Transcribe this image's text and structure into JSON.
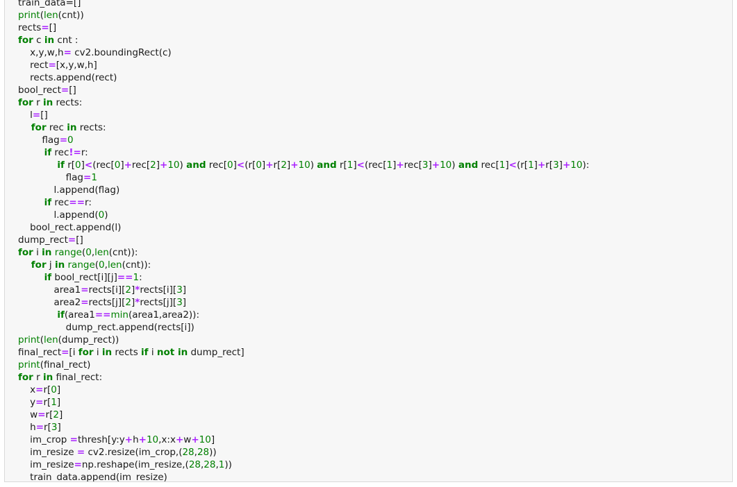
{
  "code_cell": {
    "lines": [
      [
        [
          "t",
          "train_data=[]"
        ]
      ],
      [
        [
          "b",
          "print"
        ],
        [
          "t",
          "("
        ],
        [
          "b",
          "len"
        ],
        [
          "t",
          "(cnt))"
        ]
      ],
      [
        [
          "t",
          "rects"
        ],
        [
          "o",
          "="
        ],
        [
          "t",
          "[]"
        ]
      ],
      [
        [
          "k",
          "for"
        ],
        [
          "t",
          " c "
        ],
        [
          "k",
          "in"
        ],
        [
          "t",
          " cnt :"
        ]
      ],
      [
        [
          "t",
          "    x,y,w,h"
        ],
        [
          "o",
          "="
        ],
        [
          "t",
          " cv2.boundingRect(c)"
        ]
      ],
      [
        [
          "t",
          "    rect"
        ],
        [
          "o",
          "="
        ],
        [
          "t",
          "[x,y,w,h]"
        ]
      ],
      [
        [
          "t",
          "    rects.append(rect)"
        ]
      ],
      [
        [
          "t",
          "bool_rect"
        ],
        [
          "o",
          "="
        ],
        [
          "t",
          "[]"
        ]
      ],
      [
        [
          "k",
          "for"
        ],
        [
          "t",
          " r "
        ],
        [
          "k",
          "in"
        ],
        [
          "t",
          " rects:"
        ]
      ],
      [
        [
          "t",
          "    l"
        ],
        [
          "o",
          "="
        ],
        [
          "t",
          "[]"
        ]
      ],
      [
        [
          "k",
          "    for"
        ],
        [
          "t",
          " rec "
        ],
        [
          "k",
          "in"
        ],
        [
          "t",
          " rects:"
        ]
      ],
      [
        [
          "t",
          "        flag"
        ],
        [
          "o",
          "="
        ],
        [
          "n",
          "0"
        ]
      ],
      [
        [
          "k",
          "        if"
        ],
        [
          "t",
          " rec"
        ],
        [
          "o",
          "!="
        ],
        [
          "t",
          "r:"
        ]
      ],
      [
        [
          "k",
          "            if"
        ],
        [
          "t",
          " r["
        ],
        [
          "n",
          "0"
        ],
        [
          "t",
          "]"
        ],
        [
          "o",
          "<"
        ],
        [
          "t",
          "(rec["
        ],
        [
          "n",
          "0"
        ],
        [
          "t",
          "]"
        ],
        [
          "o",
          "+"
        ],
        [
          "t",
          "rec["
        ],
        [
          "n",
          "2"
        ],
        [
          "t",
          "]"
        ],
        [
          "o",
          "+"
        ],
        [
          "n",
          "10"
        ],
        [
          "t",
          ") "
        ],
        [
          "k",
          "and"
        ],
        [
          "t",
          " rec["
        ],
        [
          "n",
          "0"
        ],
        [
          "t",
          "]"
        ],
        [
          "o",
          "<"
        ],
        [
          "t",
          "(r["
        ],
        [
          "n",
          "0"
        ],
        [
          "t",
          "]"
        ],
        [
          "o",
          "+"
        ],
        [
          "t",
          "r["
        ],
        [
          "n",
          "2"
        ],
        [
          "t",
          "]"
        ],
        [
          "o",
          "+"
        ],
        [
          "n",
          "10"
        ],
        [
          "t",
          ") "
        ],
        [
          "k",
          "and"
        ],
        [
          "t",
          " r["
        ],
        [
          "n",
          "1"
        ],
        [
          "t",
          "]"
        ],
        [
          "o",
          "<"
        ],
        [
          "t",
          "(rec["
        ],
        [
          "n",
          "1"
        ],
        [
          "t",
          "]"
        ],
        [
          "o",
          "+"
        ],
        [
          "t",
          "rec["
        ],
        [
          "n",
          "3"
        ],
        [
          "t",
          "]"
        ],
        [
          "o",
          "+"
        ],
        [
          "n",
          "10"
        ],
        [
          "t",
          ") "
        ],
        [
          "k",
          "and"
        ],
        [
          "t",
          " rec["
        ],
        [
          "n",
          "1"
        ],
        [
          "t",
          "]"
        ],
        [
          "o",
          "<"
        ],
        [
          "t",
          "(r["
        ],
        [
          "n",
          "1"
        ],
        [
          "t",
          "]"
        ],
        [
          "o",
          "+"
        ],
        [
          "t",
          "r["
        ],
        [
          "n",
          "3"
        ],
        [
          "t",
          "]"
        ],
        [
          "o",
          "+"
        ],
        [
          "n",
          "10"
        ],
        [
          "t",
          "):"
        ]
      ],
      [
        [
          "t",
          "                flag"
        ],
        [
          "o",
          "="
        ],
        [
          "n",
          "1"
        ]
      ],
      [
        [
          "t",
          "            l.append(flag)"
        ]
      ],
      [
        [
          "k",
          "        if"
        ],
        [
          "t",
          " rec"
        ],
        [
          "o",
          "=="
        ],
        [
          "t",
          "r:"
        ]
      ],
      [
        [
          "t",
          "            l.append("
        ],
        [
          "n",
          "0"
        ],
        [
          "t",
          ")"
        ]
      ],
      [
        [
          "t",
          "    bool_rect.append(l)"
        ]
      ],
      [
        [
          "t",
          "dump_rect"
        ],
        [
          "o",
          "="
        ],
        [
          "t",
          "[]"
        ]
      ],
      [
        [
          "k",
          "for"
        ],
        [
          "t",
          " i "
        ],
        [
          "k",
          "in"
        ],
        [
          "t",
          " "
        ],
        [
          "b",
          "range"
        ],
        [
          "t",
          "("
        ],
        [
          "n",
          "0"
        ],
        [
          "t",
          ","
        ],
        [
          "b",
          "len"
        ],
        [
          "t",
          "(cnt)):"
        ]
      ],
      [
        [
          "k",
          "    for"
        ],
        [
          "t",
          " j "
        ],
        [
          "k",
          "in"
        ],
        [
          "t",
          " "
        ],
        [
          "b",
          "range"
        ],
        [
          "t",
          "("
        ],
        [
          "n",
          "0"
        ],
        [
          "t",
          ","
        ],
        [
          "b",
          "len"
        ],
        [
          "t",
          "(cnt)):"
        ]
      ],
      [
        [
          "k",
          "        if"
        ],
        [
          "t",
          " bool_rect[i][j]"
        ],
        [
          "o",
          "=="
        ],
        [
          "n",
          "1"
        ],
        [
          "t",
          ":"
        ]
      ],
      [
        [
          "t",
          "            area1"
        ],
        [
          "o",
          "="
        ],
        [
          "t",
          "rects[i]["
        ],
        [
          "n",
          "2"
        ],
        [
          "t",
          "]"
        ],
        [
          "o",
          "*"
        ],
        [
          "t",
          "rects[i]["
        ],
        [
          "n",
          "3"
        ],
        [
          "t",
          "]"
        ]
      ],
      [
        [
          "t",
          "            area2"
        ],
        [
          "o",
          "="
        ],
        [
          "t",
          "rects[j]["
        ],
        [
          "n",
          "2"
        ],
        [
          "t",
          "]"
        ],
        [
          "o",
          "*"
        ],
        [
          "t",
          "rects[j]["
        ],
        [
          "n",
          "3"
        ],
        [
          "t",
          "]"
        ]
      ],
      [
        [
          "k",
          "            if"
        ],
        [
          "t",
          "(area1"
        ],
        [
          "o",
          "=="
        ],
        [
          "b",
          "min"
        ],
        [
          "t",
          "(area1,area2)):"
        ]
      ],
      [
        [
          "t",
          "                dump_rect.append(rects[i])"
        ]
      ],
      [
        [
          "b",
          "print"
        ],
        [
          "t",
          "("
        ],
        [
          "b",
          "len"
        ],
        [
          "t",
          "(dump_rect))"
        ]
      ],
      [
        [
          "t",
          "final_rect"
        ],
        [
          "o",
          "="
        ],
        [
          "t",
          "[i "
        ],
        [
          "k",
          "for"
        ],
        [
          "t",
          " i "
        ],
        [
          "k",
          "in"
        ],
        [
          "t",
          " rects "
        ],
        [
          "k",
          "if"
        ],
        [
          "t",
          " i "
        ],
        [
          "k",
          "not in"
        ],
        [
          "t",
          " dump_rect]"
        ]
      ],
      [
        [
          "b",
          "print"
        ],
        [
          "t",
          "(final_rect)"
        ]
      ],
      [
        [
          "k",
          "for"
        ],
        [
          "t",
          " r "
        ],
        [
          "k",
          "in"
        ],
        [
          "t",
          " final_rect:"
        ]
      ],
      [
        [
          "t",
          "    x"
        ],
        [
          "o",
          "="
        ],
        [
          "t",
          "r["
        ],
        [
          "n",
          "0"
        ],
        [
          "t",
          "]"
        ]
      ],
      [
        [
          "t",
          "    y"
        ],
        [
          "o",
          "="
        ],
        [
          "t",
          "r["
        ],
        [
          "n",
          "1"
        ],
        [
          "t",
          "]"
        ]
      ],
      [
        [
          "t",
          "    w"
        ],
        [
          "o",
          "="
        ],
        [
          "t",
          "r["
        ],
        [
          "n",
          "2"
        ],
        [
          "t",
          "]"
        ]
      ],
      [
        [
          "t",
          "    h"
        ],
        [
          "o",
          "="
        ],
        [
          "t",
          "r["
        ],
        [
          "n",
          "3"
        ],
        [
          "t",
          "]"
        ]
      ],
      [
        [
          "t",
          "    im_crop "
        ],
        [
          "o",
          "="
        ],
        [
          "t",
          "thresh[y:y"
        ],
        [
          "o",
          "+"
        ],
        [
          "t",
          "h"
        ],
        [
          "o",
          "+"
        ],
        [
          "n",
          "10"
        ],
        [
          "t",
          ",x:x"
        ],
        [
          "o",
          "+"
        ],
        [
          "t",
          "w"
        ],
        [
          "o",
          "+"
        ],
        [
          "n",
          "10"
        ],
        [
          "t",
          "]"
        ]
      ],
      [
        [
          "t",
          "    im_resize "
        ],
        [
          "o",
          "="
        ],
        [
          "t",
          " cv2.resize(im_crop,("
        ],
        [
          "n",
          "28"
        ],
        [
          "t",
          ","
        ],
        [
          "n",
          "28"
        ],
        [
          "t",
          "))"
        ]
      ],
      [
        [
          "t",
          "    im_resize"
        ],
        [
          "o",
          "="
        ],
        [
          "t",
          "np.reshape(im_resize,("
        ],
        [
          "n",
          "28"
        ],
        [
          "t",
          ","
        ],
        [
          "n",
          "28"
        ],
        [
          "t",
          ","
        ],
        [
          "n",
          "1"
        ],
        [
          "t",
          "))"
        ]
      ],
      [
        [
          "t",
          "    train_data.append(im_resize)"
        ]
      ]
    ]
  },
  "colors": {
    "keyword": "#008000",
    "operator": "#aa22ff",
    "text": "#1a1a1a",
    "background": "#f7f7f7",
    "border": "#d9d9d9"
  }
}
